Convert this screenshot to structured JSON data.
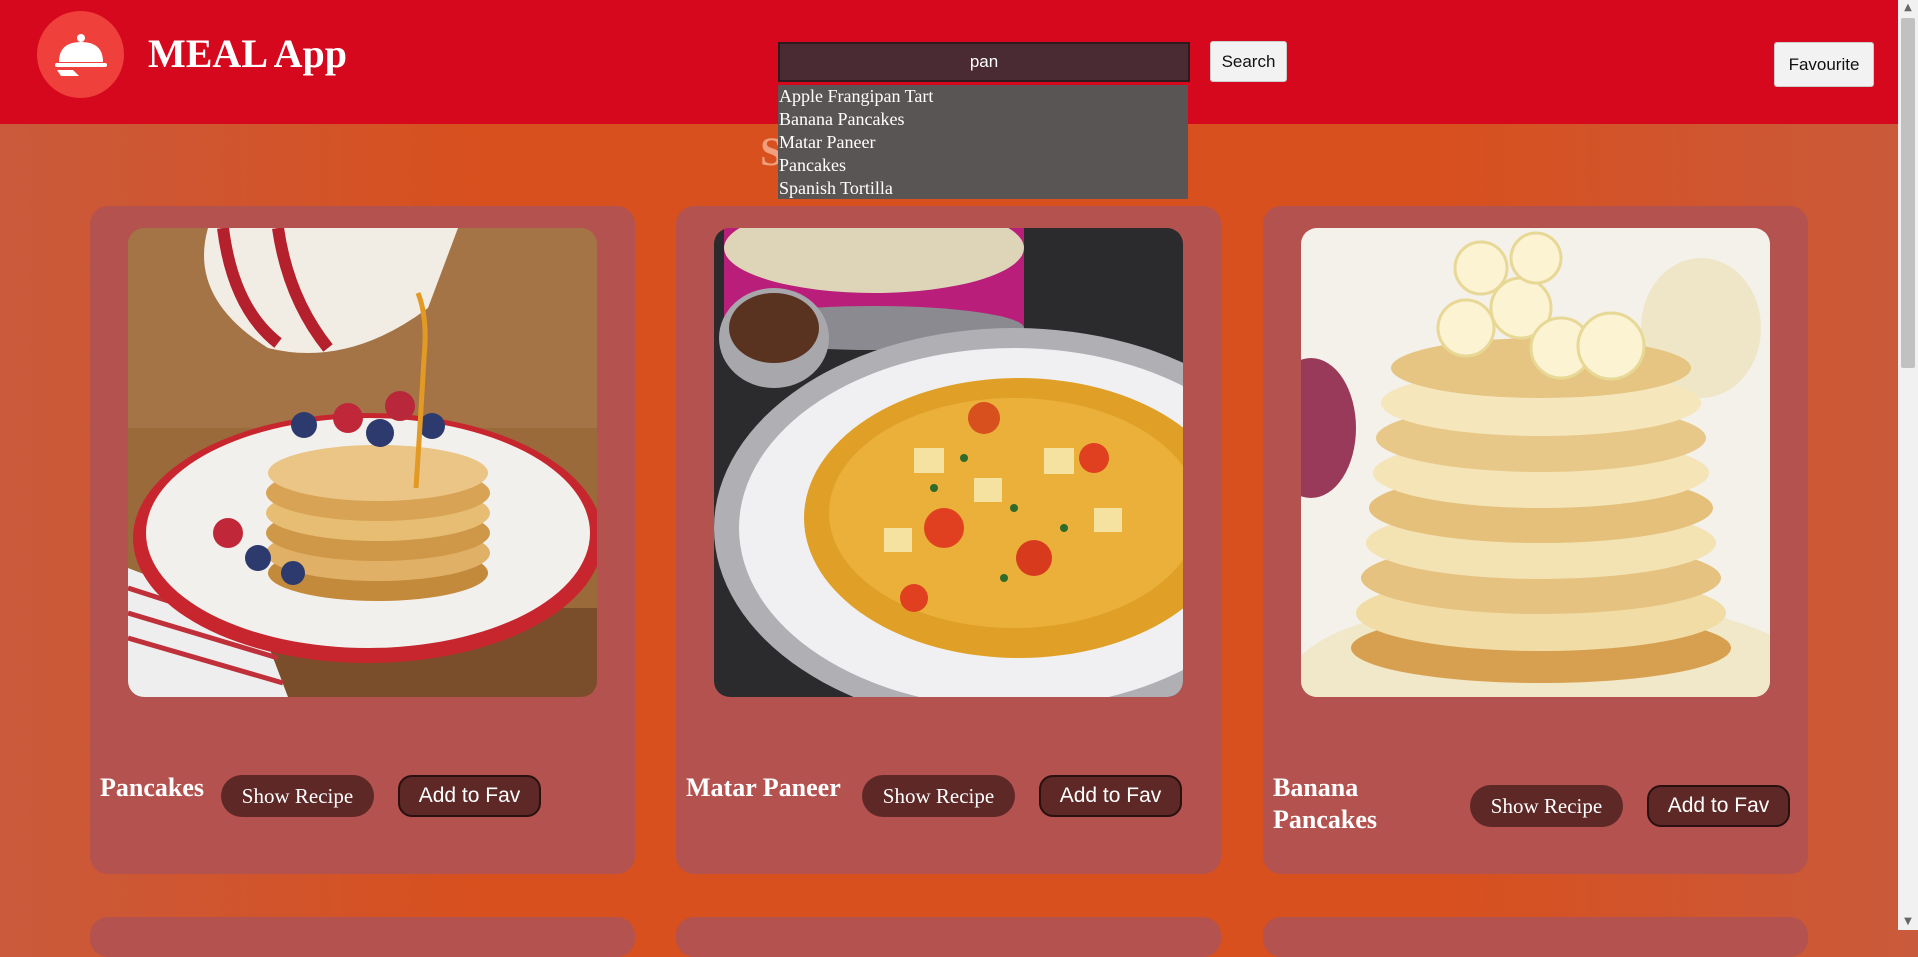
{
  "header": {
    "app_title": "MEAL App",
    "search_value": "pan",
    "search_button": "Search",
    "favourite_button": "Favourite",
    "logo_icon": "cloche-icon"
  },
  "heading": "Search results below...",
  "suggestions": [
    "Apple Frangipan Tart",
    "Banana Pancakes",
    "Matar Paneer",
    "Pancakes",
    "Spanish Tortilla"
  ],
  "cards": [
    {
      "name": "Pancakes",
      "show": "Show Recipe",
      "fav": "Add to Fav"
    },
    {
      "name": "Matar Paneer",
      "show": "Show Recipe",
      "fav": "Add to Fav"
    },
    {
      "name": "Banana Pancakes",
      "show": "Show Recipe",
      "fav": "Add to Fav"
    }
  ],
  "colors": {
    "header": "#d6081e",
    "card": "#b3524f",
    "button": "#5d2826",
    "heading": "#f0a07e"
  }
}
